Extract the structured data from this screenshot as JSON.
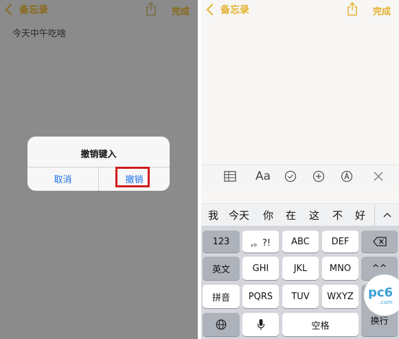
{
  "nav": {
    "back_label": "备忘录",
    "done_label": "完成"
  },
  "left": {
    "note_text": "今天中午吃啥",
    "alert": {
      "title": "撤销键入",
      "cancel_label": "取消",
      "undo_label": "撤销"
    }
  },
  "right": {
    "toolbar": {
      "format_label": "Aa"
    },
    "candidates": [
      "我",
      "今天",
      "你",
      "在",
      "这",
      "不",
      "好"
    ],
    "keys": {
      "row1": [
        "123",
        ",。?!",
        "ABC",
        "DEF"
      ],
      "row2": [
        "英文",
        "GHI",
        "JKL",
        "MNO",
        "^^"
      ],
      "row3": [
        "拼音",
        "PQRS",
        "TUV",
        "WXYZ"
      ],
      "row4": [
        "空格"
      ],
      "enter": "换行"
    }
  },
  "watermark": {
    "brand": "pc6",
    "suffix": ".com"
  },
  "colors": {
    "accent": "#e3b12f",
    "link": "#1a73e8",
    "highlight": "#d11a1a"
  }
}
